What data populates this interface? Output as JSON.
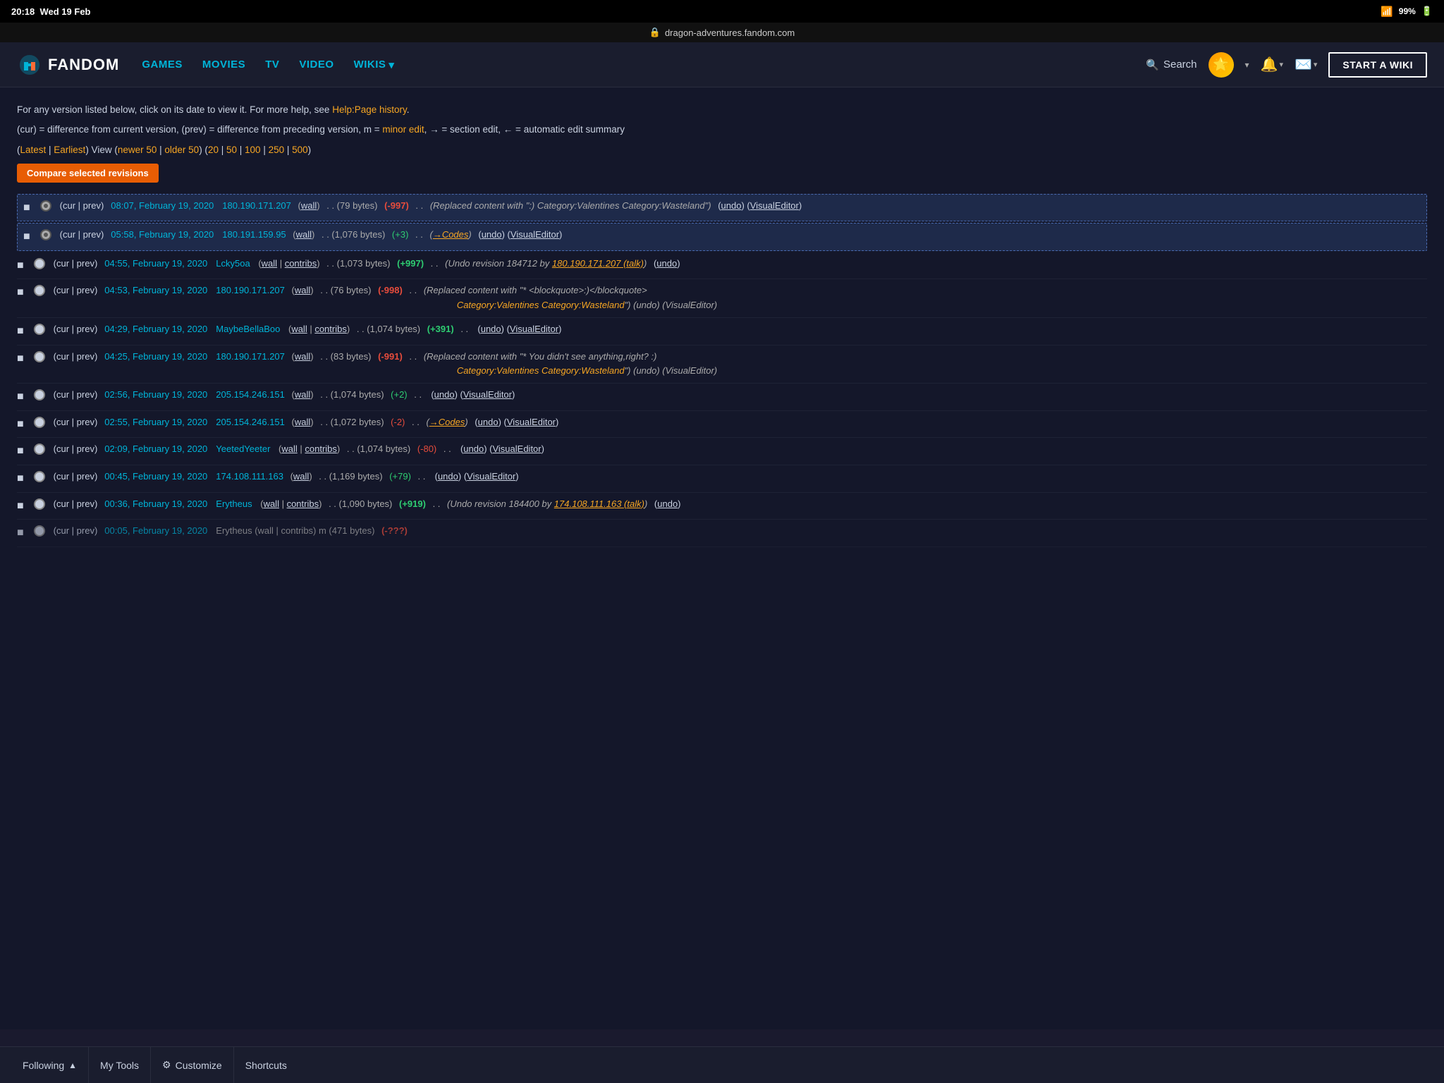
{
  "statusBar": {
    "time": "20:18",
    "date": "Wed 19 Feb",
    "wifi": "▾",
    "battery": "99%"
  },
  "urlBar": {
    "lock": "🔒",
    "url": "dragon-adventures.fandom.com"
  },
  "nav": {
    "logo": "FANDOM",
    "links": [
      "GAMES",
      "MOVIES",
      "TV",
      "VIDEO",
      "WIKIS ▾"
    ],
    "search": "Search",
    "startWiki": "START A WIKI"
  },
  "infoLines": {
    "line1": "For any version listed below, click on its date to view it. For more help, see Help:Page history.",
    "line1_link": "Help:Page history",
    "line2": "(cur) = difference from current version, (prev) = difference from preceding version, m = minor edit, → = section edit, ← = automatic edit summary",
    "line2_minor": "minor edit",
    "viewLine": "(Latest | Earliest) View (newer 50 | older 50) (20 | 50 | 100 | 250 | 500)",
    "compareBtn": "Compare selected revisions"
  },
  "revisions": [
    {
      "id": "rev1",
      "selected": true,
      "radio": "checked",
      "links": "(cur | prev)",
      "date": "08:07, February 19, 2020",
      "user": "180.190.171.207",
      "userType": "ip",
      "wallLink": "(wall)",
      "bytes": "(79 bytes)",
      "diff": "(-997)",
      "diffType": "neg",
      "comment": "(Replaced content with \"<blockquote>:)</blockquote> Category:Valentines Category:Wasteland\")",
      "actions": "(undo) (VisualEditor)"
    },
    {
      "id": "rev2",
      "selected": true,
      "radio": "checked",
      "links": "(cur | prev)",
      "date": "05:58, February 19, 2020",
      "user": "180.191.159.95",
      "userType": "ip",
      "wallLink": "(wall)",
      "bytes": "(1,076 bytes)",
      "diff": "(+3)",
      "diffType": "pos_small",
      "comment": "(→Codes)",
      "actions": "(undo) (VisualEditor)"
    },
    {
      "id": "rev3",
      "selected": false,
      "radio": "unchecked",
      "links": "(cur | prev)",
      "date": "04:55, February 19, 2020",
      "user": "Lcky5oa",
      "userType": "named",
      "wallLink": "(wall | contribs)",
      "bytes": "(1,073 bytes)",
      "diff": "(+997)",
      "diffType": "pos",
      "comment": "(Undo revision 184712 by 180.190.171.207 (talk))",
      "actions": "(undo)"
    },
    {
      "id": "rev4",
      "selected": false,
      "radio": "unchecked",
      "links": "(cur | prev)",
      "date": "04:53, February 19, 2020",
      "user": "180.190.171.207",
      "userType": "ip",
      "wallLink": "(wall)",
      "bytes": "(76 bytes)",
      "diff": "(-998)",
      "diffType": "neg",
      "comment": "(Replaced content with \"* <blockquote>:)</blockquote> Category:Valentines Category:Wasteland\")",
      "actions": "(undo) (VisualEditor)"
    },
    {
      "id": "rev5",
      "selected": false,
      "radio": "unchecked",
      "links": "(cur | prev)",
      "date": "04:29, February 19, 2020",
      "user": "MaybeBellaBoo",
      "userType": "named",
      "wallLink": "(wall | contribs)",
      "bytes": "(1,074 bytes)",
      "diff": "(+391)",
      "diffType": "pos",
      "comment": "",
      "actions": "(undo) (VisualEditor)"
    },
    {
      "id": "rev6",
      "selected": false,
      "radio": "unchecked",
      "links": "(cur | prev)",
      "date": "04:25, February 19, 2020",
      "user": "180.190.171.207",
      "userType": "ip",
      "wallLink": "(wall)",
      "bytes": "(83 bytes)",
      "diff": "(-991)",
      "diffType": "neg",
      "comment": "(Replaced content with \"* You didn't see anything,right? :) Category:Valentines Category:Wasteland\")",
      "actions": "(undo) (VisualEditor)"
    },
    {
      "id": "rev7",
      "selected": false,
      "radio": "unchecked",
      "links": "(cur | prev)",
      "date": "02:56, February 19, 2020",
      "user": "205.154.246.151",
      "userType": "ip",
      "wallLink": "(wall)",
      "bytes": "(1,074 bytes)",
      "diff": "(+2)",
      "diffType": "pos_small",
      "comment": "",
      "actions": "(undo) (VisualEditor)"
    },
    {
      "id": "rev8",
      "selected": false,
      "radio": "unchecked",
      "links": "(cur | prev)",
      "date": "02:55, February 19, 2020",
      "user": "205.154.246.151",
      "userType": "ip",
      "wallLink": "(wall)",
      "bytes": "(1,072 bytes)",
      "diff": "(-2)",
      "diffType": "neg_small",
      "comment": "(→Codes)",
      "actions": "(undo) (VisualEditor)"
    },
    {
      "id": "rev9",
      "selected": false,
      "radio": "unchecked",
      "links": "(cur | prev)",
      "date": "02:09, February 19, 2020",
      "user": "YeetedYeeter",
      "userType": "named",
      "wallLink": "(wall | contribs)",
      "bytes": "(1,074 bytes)",
      "diff": "(-80)",
      "diffType": "neg_small",
      "comment": "",
      "actions": "(undo) (VisualEditor)"
    },
    {
      "id": "rev10",
      "selected": false,
      "radio": "unchecked",
      "links": "(cur | prev)",
      "date": "00:45, February 19, 2020",
      "user": "174.108.111.163",
      "userType": "ip",
      "wallLink": "(wall)",
      "bytes": "(1,169 bytes)",
      "diff": "(+79)",
      "diffType": "pos_small",
      "comment": "",
      "actions": "(undo) (VisualEditor)"
    },
    {
      "id": "rev11",
      "selected": false,
      "radio": "unchecked",
      "links": "(cur | prev)",
      "date": "00:36, February 19, 2020",
      "user": "Erytheus",
      "userType": "named",
      "wallLink": "(wall | contribs)",
      "bytes": "(1,090 bytes)",
      "diff": "(+919)",
      "diffType": "pos",
      "comment": "(Undo revision 184400 by 174.108.111.163 (talk))",
      "actions": "(undo)"
    }
  ],
  "bottomToolbar": {
    "following": "Following",
    "myTools": "My Tools",
    "customize": "Customize",
    "shortcuts": "Shortcuts"
  }
}
